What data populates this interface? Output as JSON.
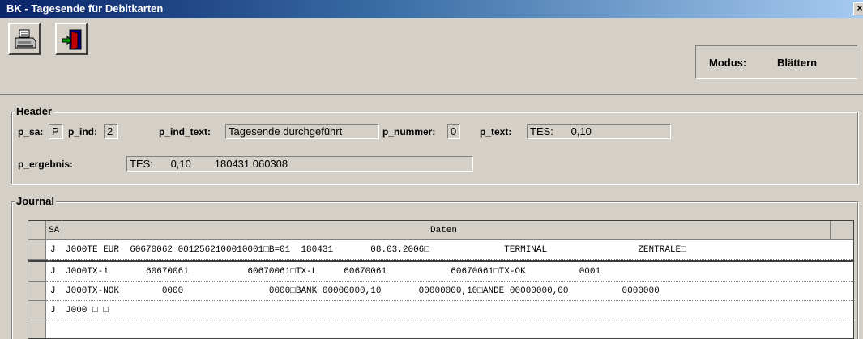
{
  "window": {
    "title": "BK - Tagesende für Debitkarten",
    "close": "×"
  },
  "toolbar": {
    "print_icon": "printer-icon",
    "exit_icon": "exit-door-icon",
    "modus_label": "Modus:",
    "modus_value": "Blättern"
  },
  "header": {
    "title": "Header",
    "p_sa_label": "p_sa:",
    "p_sa": "P",
    "p_ind_label": "p_ind:",
    "p_ind": "2",
    "p_ind_text_label": "p_ind_text:",
    "p_ind_text": "Tagesende durchgeführt",
    "p_nummer_label": "p_nummer:",
    "p_nummer": "0",
    "p_text_label": "p_text:",
    "p_text": "TES:      0,10",
    "p_ergebnis_label": "p_ergebnis:",
    "p_ergebnis": "TES:      0,10        180431 060308"
  },
  "journal": {
    "title": "Journal",
    "columns": [
      "SA",
      "Daten"
    ],
    "rows": [
      {
        "sa": "J",
        "daten": "J000TE EUR  60670062 0012562100010001□B=01  180431       08.03.2006□              TERMINAL                 ZENTRALE□"
      },
      {
        "sa": "J",
        "daten": "J000TX-1       60670061           60670061□TX-L     60670061            60670061□TX-OK          0001"
      },
      {
        "sa": "J",
        "daten": "J000TX-NOK        0000                0000□BANK 00000000,10       00000000,10□ANDE 00000000,00          0000000"
      },
      {
        "sa": "J",
        "daten": "J000 □ □"
      }
    ]
  }
}
